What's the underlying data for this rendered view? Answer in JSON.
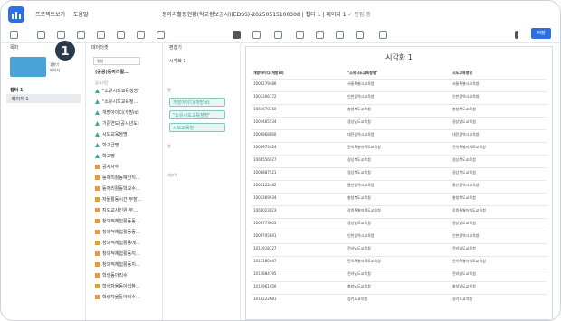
{
  "app": {
    "menu": [
      "프로젝트",
      "보기",
      "도움말"
    ],
    "document_title": "동아리활동현황(학교정보공시)(EDSS)-20250515100308",
    "title_sep": "|",
    "chapter_page": "챕터 1 | 페이지 1",
    "saved_status": "✓ 편집 중",
    "share_label": "저장"
  },
  "left_panel": {
    "header": "목차",
    "thumb_note": [
      "1행이",
      "페이지"
    ],
    "badge": "1",
    "chapter": "챕터 1",
    "page": "페이지 1"
  },
  "data_panel": {
    "header": "데이터셋",
    "selector": "명칭",
    "dataset_name": "(공공)동아리활...",
    "group": "공시기간",
    "fields": [
      {
        "label": "\"소유시도교육청명\"",
        "type": "teal"
      },
      {
        "label": "\"소유시도교육청...",
        "type": "teal"
      },
      {
        "label": "개방아이디(개방id)",
        "type": "teal"
      },
      {
        "label": "기준연도(공시년도)",
        "type": "teal"
      },
      {
        "label": "시도교육청명",
        "type": "teal"
      },
      {
        "label": "학교급명",
        "type": "teal"
      },
      {
        "label": "학교명",
        "type": "teal"
      },
      {
        "label": "공시차수",
        "type": "orange"
      },
      {
        "label": "동아리활동예산지...",
        "type": "orange"
      },
      {
        "label": "동아리활동학교수...",
        "type": "orange"
      },
      {
        "label": "자율활동시간(부장...",
        "type": "orange"
      },
      {
        "label": "지도교사인원(부...",
        "type": "orange"
      },
      {
        "label": "창의적체험활동동...",
        "type": "orange"
      },
      {
        "label": "창의적체험활동동...",
        "type": "orange"
      },
      {
        "label": "창의적체험활동에...",
        "type": "orange"
      },
      {
        "label": "창의적체험활동지...",
        "type": "orange"
      },
      {
        "label": "창의적체험활동지...",
        "type": "orange"
      },
      {
        "label": "학생동아리수",
        "type": "orange"
      },
      {
        "label": "학생자율동아리참...",
        "type": "orange"
      },
      {
        "label": "학생자율동아리수...",
        "type": "orange"
      }
    ]
  },
  "editor_panel": {
    "header": "편집기",
    "viz_name": "시각화 1",
    "rows_label": "행",
    "pills": [
      "개방아이디(개방id)",
      "\"소유시도교육청명\"",
      "시도교육청"
    ],
    "columns_label": "열",
    "filter_label": "세부적"
  },
  "viz": {
    "title": "시각화 1",
    "columns": [
      "개방아이디(개방id)",
      "\"소유시도교육청명\"",
      "시도교육청명"
    ],
    "rows": [
      [
        "1000279486",
        "서울특별시교육청",
        "서울특별시교육청"
      ],
      [
        "1001306772",
        "인천광역시교육청",
        "인천광역시교육청"
      ],
      [
        "1001970350",
        "충청북도교육청",
        "충청북도교육청"
      ],
      [
        "1002485534",
        "경상남도교육청",
        "경상남도교육청"
      ],
      [
        "1003968060",
        "대전광역시교육청",
        "대전광역시교육청"
      ],
      [
        "1003973424",
        "전북특별자치도교육청",
        "전북특별자치도교육청"
      ],
      [
        "1004556927",
        "경상북도교육청",
        "경상북도교육청"
      ],
      [
        "1004887521",
        "경상북도교육청",
        "경상북도교육청"
      ],
      [
        "1005122482",
        "울산광역시교육청",
        "울산광역시교육청"
      ],
      [
        "1005369934",
        "충청북도교육청",
        "충청북도교육청"
      ],
      [
        "1008023023",
        "강원특별자치도교육청",
        "강원특별자치도교육청"
      ],
      [
        "1008773605",
        "경상남도교육청",
        "경상남도교육청"
      ],
      [
        "1009705841",
        "인천광역시교육청",
        "인천광역시교육청"
      ],
      [
        "1011918127",
        "전라남도교육청",
        "전라남도교육청"
      ],
      [
        "1012180447",
        "전북특별자치도교육청",
        "전북특별자치도교육청"
      ],
      [
        "1012884795",
        "전라남도교육청",
        "전라남도교육청"
      ],
      [
        "1012961956",
        "충청남도교육청",
        "충청남도교육청"
      ],
      [
        "1014222681",
        "경기도교육청",
        "경기도교육청"
      ]
    ]
  }
}
